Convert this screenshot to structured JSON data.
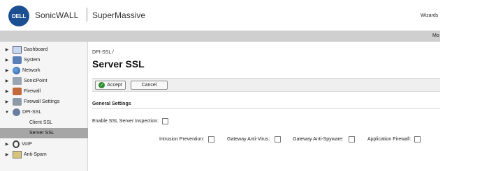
{
  "header": {
    "logo_text": "DELL",
    "brand": "SonicWALL",
    "product": "SuperMassive",
    "wizards": "Wizards",
    "topbar_label": "Mo"
  },
  "sidebar": {
    "items": [
      {
        "label": "Dashboard",
        "icon": "dashboard-icon",
        "expanded": false
      },
      {
        "label": "System",
        "icon": "system-icon",
        "expanded": false
      },
      {
        "label": "Network",
        "icon": "network-icon",
        "expanded": false
      },
      {
        "label": "SonicPoint",
        "icon": "sonicpoint-icon",
        "expanded": false
      },
      {
        "label": "Firewall",
        "icon": "firewall-icon",
        "expanded": false
      },
      {
        "label": "Firewall Settings",
        "icon": "firewall-settings-icon",
        "expanded": false
      },
      {
        "label": "DPI-SSL",
        "icon": "dpi-ssl-icon",
        "expanded": true
      },
      {
        "label": "VoIP",
        "icon": "voip-icon",
        "expanded": false
      },
      {
        "label": "Anti-Spam",
        "icon": "anti-spam-icon",
        "expanded": false
      }
    ],
    "subitems": [
      {
        "label": "Client SSL",
        "selected": false
      },
      {
        "label": "Server SSL",
        "selected": true
      }
    ]
  },
  "main": {
    "breadcrumb": "DPI-SSL /",
    "title": "Server SSL",
    "toolbar": {
      "accept_label": "Accept",
      "cancel_label": "Cancel"
    },
    "section_title": "General Settings",
    "enable_label": "Enable SSL Server Inspection:",
    "options": [
      {
        "label": "Intrusion Prevention:",
        "checked": false
      },
      {
        "label": "Gateway Anti-Virus:",
        "checked": false
      },
      {
        "label": "Gateway Anti-Spyware:",
        "checked": false
      },
      {
        "label": "Application Firewall:",
        "checked": false
      }
    ]
  }
}
